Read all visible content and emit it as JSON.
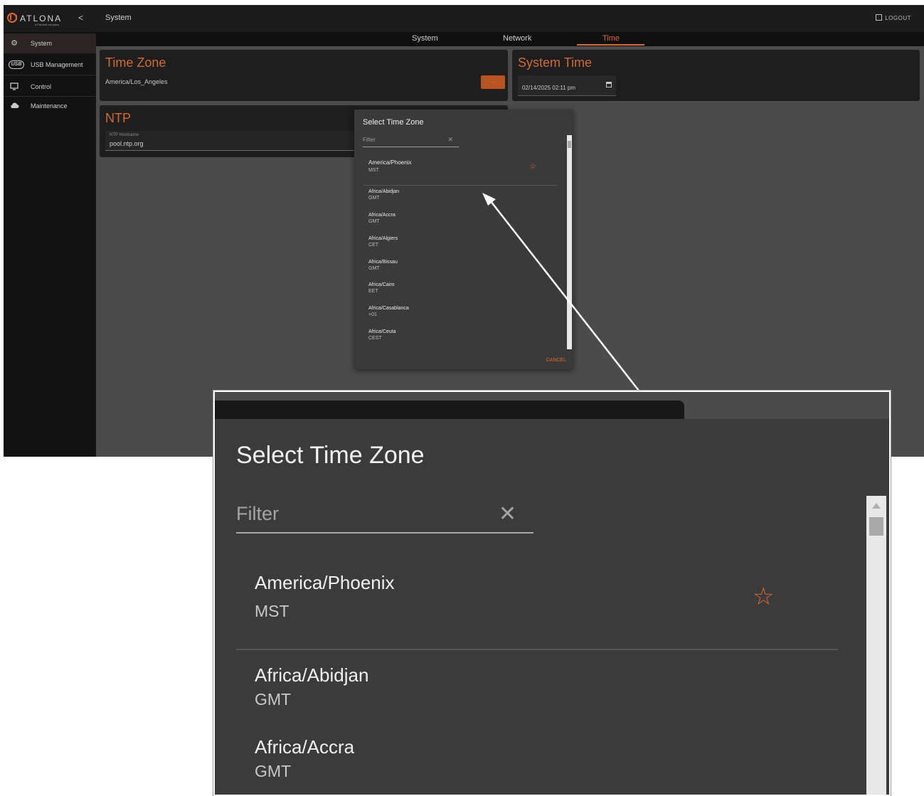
{
  "app": {
    "brand": "ATLONA",
    "brand_sub": "a Panduit company",
    "page_title": "System",
    "logout_label": "LOGOUT",
    "collapse_glyph": "<"
  },
  "sidebar": {
    "items": [
      {
        "label": "System",
        "icon": "gear-icon",
        "active": true
      },
      {
        "label": "USB Management",
        "icon": "usb-icon",
        "active": false
      },
      {
        "label": "Control",
        "icon": "monitor-icon",
        "active": false
      },
      {
        "label": "Maintenance",
        "icon": "cloud-icon",
        "active": false
      }
    ]
  },
  "tabs": [
    {
      "label": "System",
      "active": false
    },
    {
      "label": "Network",
      "active": false
    },
    {
      "label": "Time",
      "active": true
    }
  ],
  "time_zone_card": {
    "title": "Time Zone",
    "value": "America/Los_Angeles"
  },
  "ntp_card": {
    "title": "NTP",
    "field_label": "NTP Hostname",
    "field_value": "pool.ntp.org"
  },
  "system_time_card": {
    "title": "System Time",
    "value": "02/14/2025 02:11 pm"
  },
  "dialog": {
    "title": "Select Time Zone",
    "filter_placeholder": "Filter",
    "favorite": {
      "name": "America/Phoenix",
      "abbr": "MST"
    },
    "zones": [
      {
        "name": "Africa/Abidjan",
        "abbr": "GMT"
      },
      {
        "name": "Africa/Accra",
        "abbr": "GMT"
      },
      {
        "name": "Africa/Algiers",
        "abbr": "CET"
      },
      {
        "name": "Africa/Bissau",
        "abbr": "GMT"
      },
      {
        "name": "Africa/Cairo",
        "abbr": "EET"
      },
      {
        "name": "Africa/Casablanca",
        "abbr": "+01"
      },
      {
        "name": "Africa/Ceuta",
        "abbr": "CEST"
      }
    ],
    "cancel_label": "CANCEL"
  },
  "colors": {
    "accent": "#e0672a",
    "background": "#4b4b4b",
    "sidebar": "#121212",
    "dialog": "#3a3a3a"
  }
}
